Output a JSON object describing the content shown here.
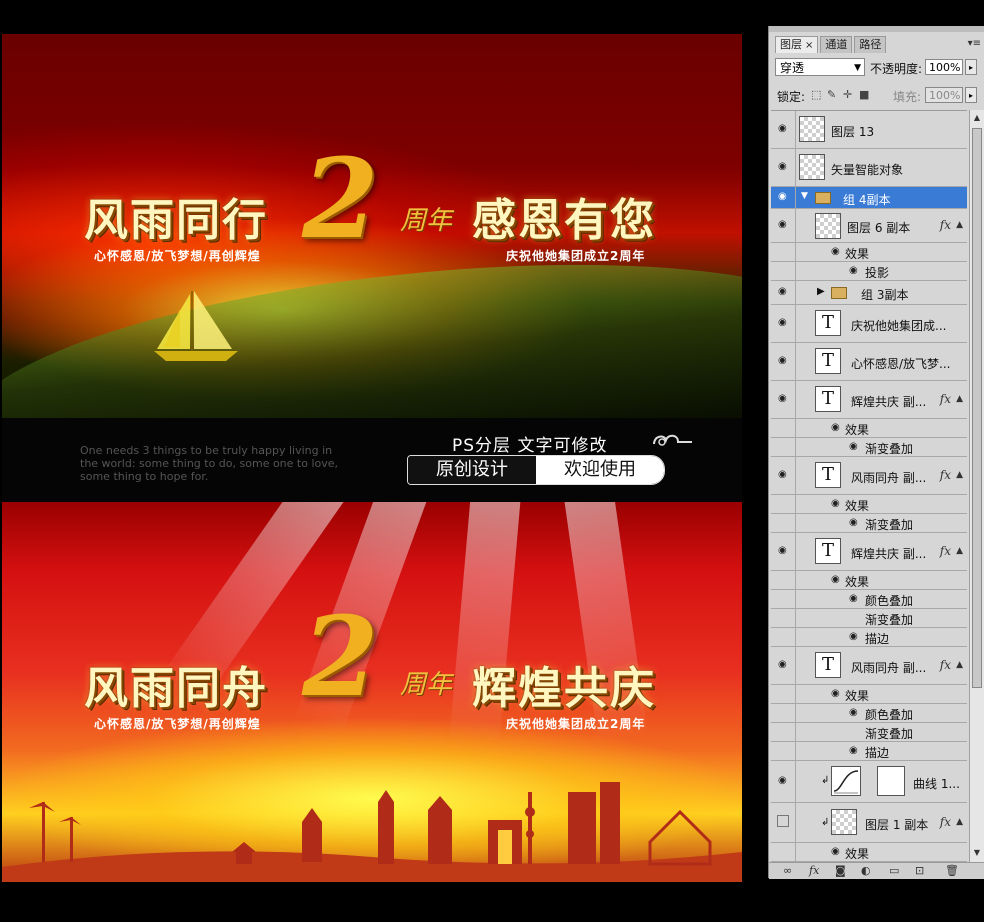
{
  "banner1": {
    "left_title": "风雨同行",
    "right_title": "感恩有您",
    "number": "2",
    "anniv": "周年",
    "left_sub": "心怀感恩/放飞梦想/再创辉煌",
    "right_sub": "庆祝他她集团成立2周年"
  },
  "infobar": {
    "english_text": "One needs 3 things to be truly happy living in the world: some thing to do, some one to love, some thing to hope for.",
    "ps_note": "PS分层  文字可修改",
    "pill_left": "原创设计",
    "pill_right": "欢迎使用"
  },
  "banner2": {
    "left_title": "风雨同舟",
    "right_title": "辉煌共庆",
    "number": "2",
    "anniv": "周年",
    "left_sub": "心怀感恩/放飞梦想/再创辉煌",
    "right_sub": "庆祝他她集团成立2周年"
  },
  "panel": {
    "tabs": [
      "图层",
      "通道",
      "路径"
    ],
    "tab_close": "×",
    "blend_mode": "穿透",
    "opacity_label": "不透明度:",
    "opacity_value": "100%",
    "lock_label": "锁定:",
    "fill_label": "填充:",
    "fill_value": "100%",
    "layers": [
      {
        "name": "图层 13"
      },
      {
        "name": "矢量智能对象"
      },
      {
        "name": "组 4副本"
      },
      {
        "name": "图层 6 副本",
        "fx": "fx"
      },
      {
        "name": "效果"
      },
      {
        "name": "投影"
      },
      {
        "name": "组 3副本"
      },
      {
        "name": "庆祝他她集团成..."
      },
      {
        "name": "心怀感恩/放飞梦..."
      },
      {
        "name": "辉煌共庆 副...",
        "fx": "fx"
      },
      {
        "name": "效果"
      },
      {
        "name": "渐变叠加"
      },
      {
        "name": "风雨同舟 副...",
        "fx": "fx"
      },
      {
        "name": "效果"
      },
      {
        "name": "渐变叠加"
      },
      {
        "name": "辉煌共庆 副...",
        "fx": "fx"
      },
      {
        "name": "效果"
      },
      {
        "name": "颜色叠加"
      },
      {
        "name": "渐变叠加"
      },
      {
        "name": "描边"
      },
      {
        "name": "风雨同舟 副...",
        "fx": "fx"
      },
      {
        "name": "效果"
      },
      {
        "name": "颜色叠加"
      },
      {
        "name": "渐变叠加"
      },
      {
        "name": "描边"
      },
      {
        "name": "曲线 1..."
      },
      {
        "name": "图层 1 副本",
        "fx": "fx"
      },
      {
        "name": "效果"
      }
    ]
  }
}
